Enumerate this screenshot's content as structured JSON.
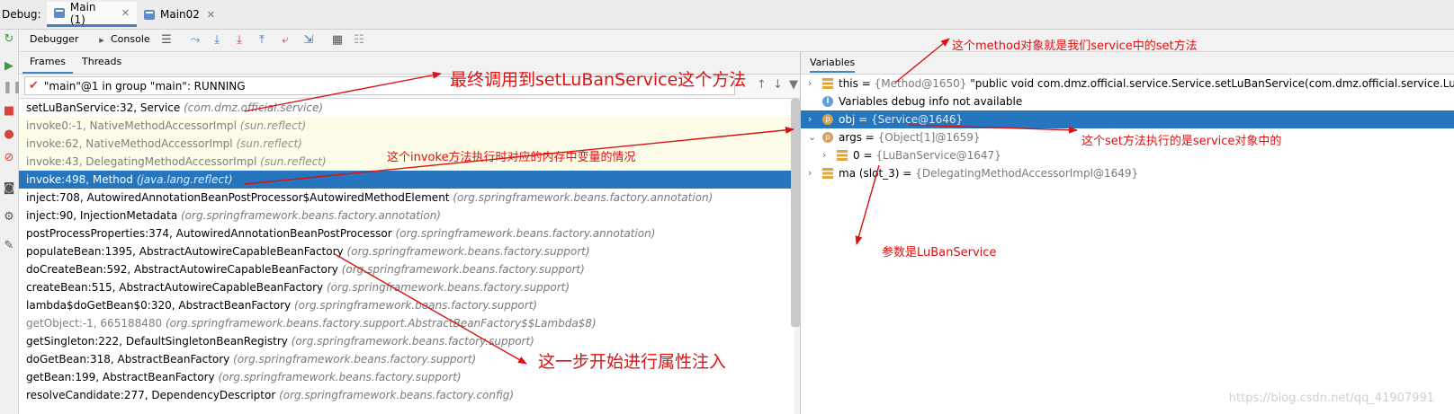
{
  "session": {
    "label": "Debug:",
    "tabs": [
      {
        "label": "Main (1)",
        "active": true
      },
      {
        "label": "Main02",
        "active": false
      }
    ]
  },
  "toolbar": {
    "debugger_tab": "Debugger",
    "console_tab": "Console"
  },
  "frames_panel": {
    "tabs": [
      "Frames",
      "Threads"
    ],
    "thread_selector": "\"main\"@1 in group \"main\": RUNNING",
    "frames": [
      {
        "method": "setLuBanService:32, Service",
        "pkg": "(com.dmz.official.service)",
        "style": "normal"
      },
      {
        "method": "invoke0:-1, NativeMethodAccessorImpl",
        "pkg": "(sun.reflect)",
        "style": "lib"
      },
      {
        "method": "invoke:62, NativeMethodAccessorImpl",
        "pkg": "(sun.reflect)",
        "style": "lib"
      },
      {
        "method": "invoke:43, DelegatingMethodAccessorImpl",
        "pkg": "(sun.reflect)",
        "style": "lib"
      },
      {
        "method": "invoke:498, Method",
        "pkg": "(java.lang.reflect)",
        "style": "selected"
      },
      {
        "method": "inject:708, AutowiredAnnotationBeanPostProcessor$AutowiredMethodElement",
        "pkg": "(org.springframework.beans.factory.annotation)",
        "style": "normal"
      },
      {
        "method": "inject:90, InjectionMetadata",
        "pkg": "(org.springframework.beans.factory.annotation)",
        "style": "normal"
      },
      {
        "method": "postProcessProperties:374, AutowiredAnnotationBeanPostProcessor",
        "pkg": "(org.springframework.beans.factory.annotation)",
        "style": "normal"
      },
      {
        "method": "populateBean:1395, AbstractAutowireCapableBeanFactory",
        "pkg": "(org.springframework.beans.factory.support)",
        "style": "normal"
      },
      {
        "method": "doCreateBean:592, AbstractAutowireCapableBeanFactory",
        "pkg": "(org.springframework.beans.factory.support)",
        "style": "normal"
      },
      {
        "method": "createBean:515, AbstractAutowireCapableBeanFactory",
        "pkg": "(org.springframework.beans.factory.support)",
        "style": "normal"
      },
      {
        "method": "lambda$doGetBean$0:320, AbstractBeanFactory",
        "pkg": "(org.springframework.beans.factory.support)",
        "style": "normal"
      },
      {
        "method": "getObject:-1, 665188480",
        "pkg": "(org.springframework.beans.factory.support.AbstractBeanFactory$$Lambda$8)",
        "style": "dim"
      },
      {
        "method": "getSingleton:222, DefaultSingletonBeanRegistry",
        "pkg": "(org.springframework.beans.factory.support)",
        "style": "normal"
      },
      {
        "method": "doGetBean:318, AbstractBeanFactory",
        "pkg": "(org.springframework.beans.factory.support)",
        "style": "normal"
      },
      {
        "method": "getBean:199, AbstractBeanFactory",
        "pkg": "(org.springframework.beans.factory.support)",
        "style": "normal"
      },
      {
        "method": "resolveCandidate:277, DependencyDescriptor",
        "pkg": "(org.springframework.beans.factory.config)",
        "style": "normal"
      }
    ]
  },
  "variables_panel": {
    "title": "Variables",
    "rows": [
      {
        "indent": 0,
        "expand": ">",
        "icon": "field",
        "name": "this",
        "eq": " = ",
        "value": "{Method@1650}",
        "extra": " \"public void com.dmz.official.service.Service.setLuBanService(com.dmz.official.service.LuBa",
        "selected": false
      },
      {
        "indent": 0,
        "expand": "",
        "icon": "info",
        "name": "Variables debug info not available",
        "eq": "",
        "value": "",
        "extra": "",
        "selected": false
      },
      {
        "indent": 0,
        "expand": ">",
        "icon": "param",
        "name": "obj",
        "eq": " = ",
        "value": "{Service@1646}",
        "extra": "",
        "selected": true
      },
      {
        "indent": 0,
        "expand": "v",
        "icon": "param",
        "name": "args",
        "eq": " = ",
        "value": "{Object[1]@1659}",
        "extra": "",
        "selected": false
      },
      {
        "indent": 1,
        "expand": ">",
        "icon": "field",
        "name": "0",
        "eq": " = ",
        "value": "{LuBanService@1647}",
        "extra": "",
        "selected": false
      },
      {
        "indent": 0,
        "expand": ">",
        "icon": "field",
        "name": "ma (slot_3)",
        "eq": " = ",
        "value": "{DelegatingMethodAccessorImpl@1649}",
        "extra": "",
        "selected": false
      }
    ]
  },
  "annotations": {
    "final_call": "最终调用到setLuBanService这个方法",
    "invoke_memory": "这个invoke方法执行时对应的内存中变量的情况",
    "property_injection": "这一步开始进行属性注入",
    "method_object": "这个method对象就是我们service中的set方法",
    "set_exec": "这个set方法执行的是service对象中的",
    "param": "参数是LuBanService"
  },
  "watermark": "https://blog.csdn.net/qq_41907991",
  "colors": {
    "selection": "#2675bf",
    "annotation": "#dd1111",
    "tab_accent": "#4083c9"
  }
}
